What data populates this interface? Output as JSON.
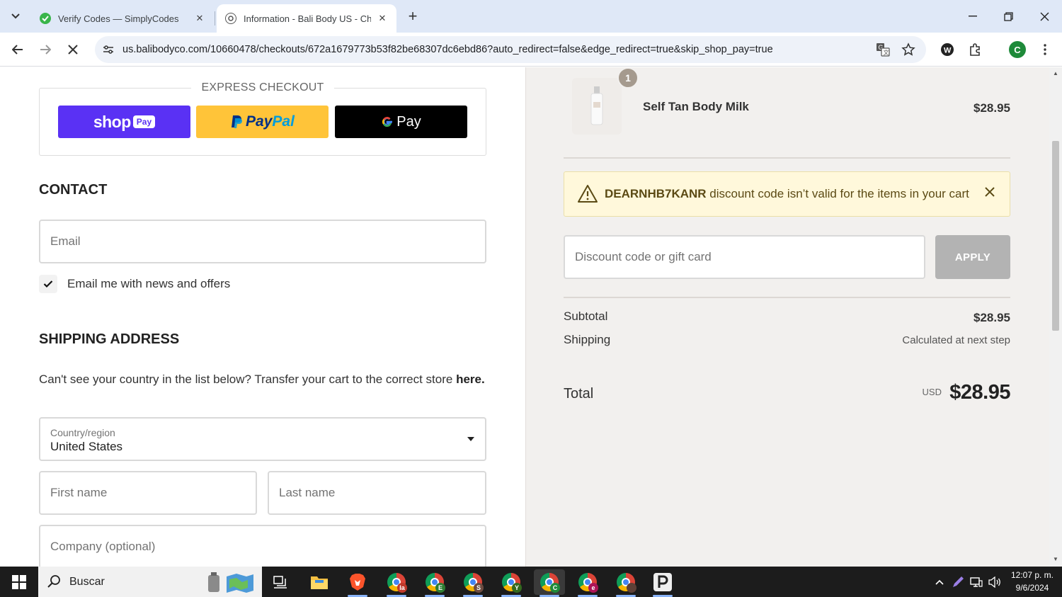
{
  "browser": {
    "tabs": [
      {
        "title": "Verify Codes — SimplyCodes",
        "active": false
      },
      {
        "title": "Information - Bali Body US - Ch",
        "active": true
      }
    ],
    "url": "us.balibodyco.com/10660478/checkouts/672a1679773b53f82be68307dc6ebd86?auto_redirect=false&edge_redirect=true&skip_shop_pay=true",
    "profile_initial": "C"
  },
  "express_checkout": {
    "heading": "EXPRESS CHECKOUT",
    "shop_pay": {
      "word": "shop",
      "badge": "Pay"
    },
    "paypal": {
      "p1": "Pay",
      "p2": "Pal"
    },
    "gpay": {
      "g": "G",
      "label": "Pay"
    }
  },
  "contact": {
    "heading": "CONTACT",
    "email_placeholder": "Email",
    "newsletter_label": "Email me with news and offers",
    "newsletter_checked": true
  },
  "shipping": {
    "heading": "SHIPPING ADDRESS",
    "transfer_text": "Can't see your country in the list below? Transfer your cart to the correct store ",
    "transfer_link": "here.",
    "country_label": "Country/region",
    "country_value": "United States",
    "first_name_placeholder": "First name",
    "last_name_placeholder": "Last name",
    "company_placeholder": "Company (optional)"
  },
  "order": {
    "item": {
      "name": "Self Tan Body Milk",
      "price": "$28.95",
      "quantity": "1"
    },
    "alert": {
      "code": "DEARNHB7KANR",
      "message": " discount code isn’t valid for the items in your cart"
    },
    "discount_placeholder": "Discount code or gift card",
    "apply_label": "APPLY",
    "subtotal_label": "Subtotal",
    "subtotal_value": "$28.95",
    "shipping_label": "Shipping",
    "shipping_value": "Calculated at next step",
    "total_label": "Total",
    "currency": "USD",
    "total_value": "$28.95"
  },
  "taskbar": {
    "search_label": "Buscar",
    "chrome_badges": [
      "Ia",
      "E",
      "S",
      "Y",
      "C",
      "e",
      ""
    ],
    "time": "12:07 p. m.",
    "date": "9/6/2024"
  },
  "colors": {
    "shop_pay": "#5a31f4",
    "paypal": "#ffc439",
    "alert_bg": "#fff8db",
    "sidebar_bg": "#f2f0ee"
  }
}
